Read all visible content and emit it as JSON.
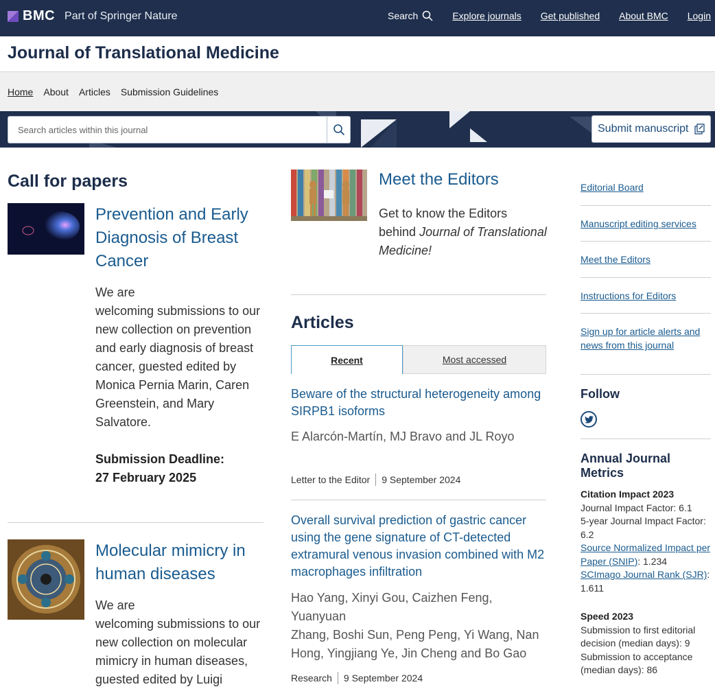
{
  "topbar": {
    "brand": "BMC",
    "brand_sub": "Part of Springer Nature",
    "search_label": "Search",
    "nav": [
      "Explore journals",
      "Get published",
      "About BMC",
      "Login"
    ]
  },
  "journal": {
    "title": "Journal of Translational Medicine",
    "subnav": [
      "Home",
      "About",
      "Articles",
      "Submission Guidelines"
    ]
  },
  "search": {
    "placeholder": "Search articles within this journal",
    "submit_label": "Submit manuscript"
  },
  "call_for_papers": {
    "heading": "Call for papers",
    "items": [
      {
        "title_lines": [
          "Prevention and Early",
          "Diagnosis of Breast",
          "Cancer"
        ],
        "body_lines": [
          "We are",
          "welcoming submissions to our",
          "new collection on prevention",
          "and early diagnosis of breast",
          "cancer, guested edited by",
          "Monica Pernia Marin, Caren",
          "Greenstein, and Mary",
          "Salvatore."
        ],
        "deadline_lines": [
          "Submission Deadline:",
          "27 February 2025"
        ]
      },
      {
        "title_lines": [
          "Molecular mimicry in",
          "human diseases"
        ],
        "body_lines": [
          "We are",
          "welcoming submissions to our",
          "new collection on molecular",
          "mimicry in human diseases,",
          "guested edited by Luigi"
        ]
      }
    ]
  },
  "meet_editors": {
    "title": "Meet the Editors",
    "body_lines": [
      "Get to know the Editors",
      "behind Journal of Translational",
      "Medicine!"
    ]
  },
  "articles": {
    "heading": "Articles",
    "tabs": [
      "Recent",
      "Most accessed"
    ],
    "items": [
      {
        "title_lines": [
          "Beware of the structural heterogeneity among",
          "SIRPB1 isoforms"
        ],
        "authors_lines": [
          "E Alarcón-Martín, MJ Bravo and JL Royo"
        ],
        "type": "Letter to the Editor",
        "date": "9 September 2024"
      },
      {
        "title_lines": [
          "Overall survival prediction of gastric cancer",
          "using the gene signature of CT-detected",
          "extramural venous invasion combined with M2",
          "macrophages infiltration"
        ],
        "authors_lines": [
          "Hao Yang, Xinyi Gou, Caizhen Feng, Yuanyuan",
          "Zhang, Boshi Sun, Peng Peng, Yi Wang, Nan",
          "Hong, Yingjiang Ye, Jin Cheng and Bo Gao"
        ],
        "type": "Research",
        "date": "9 September 2024"
      }
    ]
  },
  "sidebar": {
    "links": [
      [
        "Editorial Board"
      ],
      [
        "Manuscript editing services"
      ],
      [
        "Meet the Editors"
      ],
      [
        "Instructions for Editors"
      ],
      [
        "Sign up for article alerts and",
        "news from this journal"
      ]
    ],
    "follow_heading": "Follow",
    "metrics_heading": "Annual Journal Metrics",
    "citation": {
      "heading": "Citation Impact 2023",
      "jif": "Journal Impact Factor: 6.1",
      "five_year_lines": [
        "5-year Journal Impact Factor:",
        "6.2"
      ],
      "snip_link_lines": [
        "Source Normalized Impact per",
        "Paper (SNIP)"
      ],
      "snip_value": ": 1.234",
      "sjr_link": "SCImago Journal Rank (SJR)",
      "sjr_sep": ":",
      "sjr_value": "1.611"
    },
    "speed": {
      "heading": "Speed 2023",
      "lines": [
        "Submission to first editorial",
        "decision (median days): 9",
        "Submission to acceptance",
        "(median days): 86"
      ]
    }
  },
  "colors": {
    "navy": "#1f2f4d",
    "link": "#1a5b8f",
    "heading": "#1c2d4a"
  }
}
